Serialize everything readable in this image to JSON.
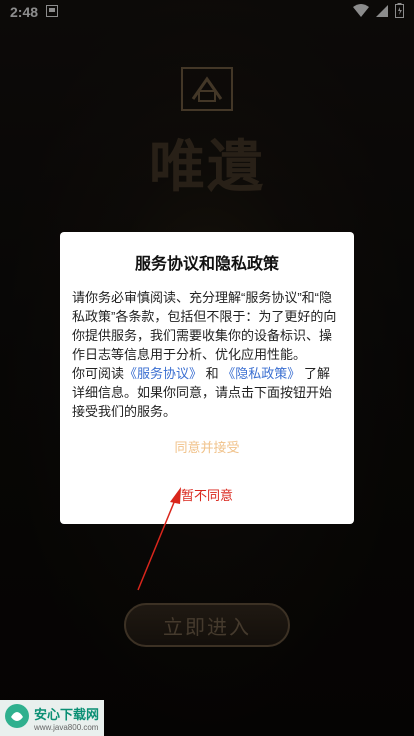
{
  "status_bar": {
    "time": "2:48"
  },
  "background": {
    "logo_text": "唯遺",
    "enter_button_label": "立即进入"
  },
  "dialog": {
    "title": "服务协议和隐私政策",
    "body_intro": "请你务必审慎阅读、充分理解“服务协议”和“隐私政策”各条款，包括但不限于：为了更好的向你提供服务，我们需要收集你的设备标识、操作日志等信息用于分析、优化应用性能。",
    "body_read_prefix": "你可阅读",
    "service_link": "《服务协议》",
    "and_text": "和",
    "privacy_link": "《隐私政策》",
    "body_suffix": "了解详细信息。如果你同意，请点击下面按钮开始接受我们的服务。",
    "accept_label": "同意并接受",
    "decline_label": "暂不同意"
  },
  "watermark": {
    "title": "安心下载网",
    "url": "www.java800.com"
  },
  "colors": {
    "link": "#3b6fd1",
    "accept": "#f0c28a",
    "decline": "#d9261c"
  }
}
